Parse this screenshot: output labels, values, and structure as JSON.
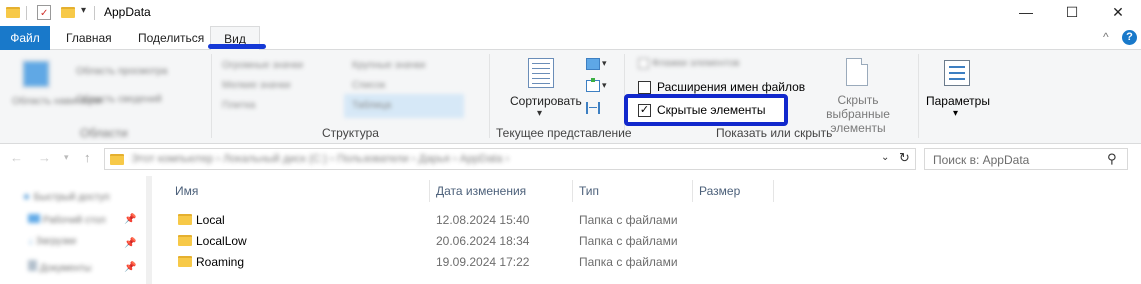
{
  "window": {
    "title": "AppData",
    "controls": [
      "—",
      "☐",
      "✕"
    ]
  },
  "tabs": [
    "Файл",
    "Главная",
    "Поделиться",
    "Вид"
  ],
  "ribbon": {
    "blurred_panes_label": "Области",
    "panes_btn1": "Область навигации",
    "panes_btn2": "Область просмотра",
    "panes_btn3": "Область сведений",
    "layout_opt1": "Огромные значки",
    "layout_opt2": "Крупные значки",
    "layout_opt3": "Мелкие значки",
    "layout_opt4": "Список",
    "layout_opt5": "Плитка",
    "layout_opt6": "Таблица",
    "structure_label": "Структура",
    "sort_label": "Сортировать",
    "current_view_label": "Текущее представление",
    "show_hide": {
      "item_checkboxes": "Флажки элементов",
      "file_extensions": "Расширения имен файлов",
      "hidden_items": "Скрытые элементы",
      "hidden_items_checked": true,
      "hide_selected_line1": "Скрыть выбранные",
      "hide_selected_line2": "элементы",
      "group_label": "Показать или скрыть"
    },
    "options_label": "Параметры",
    "options_arrow": "▾",
    "help": "?",
    "collapse": "^"
  },
  "address": {
    "crumbs": [
      "Этот компьютер",
      "Локальный диск (C:)",
      "Пользователи",
      "Дарья",
      "AppData"
    ],
    "search_placeholder": "Поиск в: AppData"
  },
  "nav": {
    "items": [
      "Быстрый доступ",
      "Рабочий стол",
      "Загрузки",
      "Документы"
    ]
  },
  "columns": [
    "Имя",
    "Дата изменения",
    "Тип",
    "Размер"
  ],
  "rows": [
    {
      "name": "Local",
      "date": "12.08.2024 15:40",
      "type": "Папка с файлами",
      "size": ""
    },
    {
      "name": "LocalLow",
      "date": "20.06.2024 18:34",
      "type": "Папка с файлами",
      "size": ""
    },
    {
      "name": "Roaming",
      "date": "19.09.2024 17:22",
      "type": "Папка с файлами",
      "size": ""
    }
  ]
}
